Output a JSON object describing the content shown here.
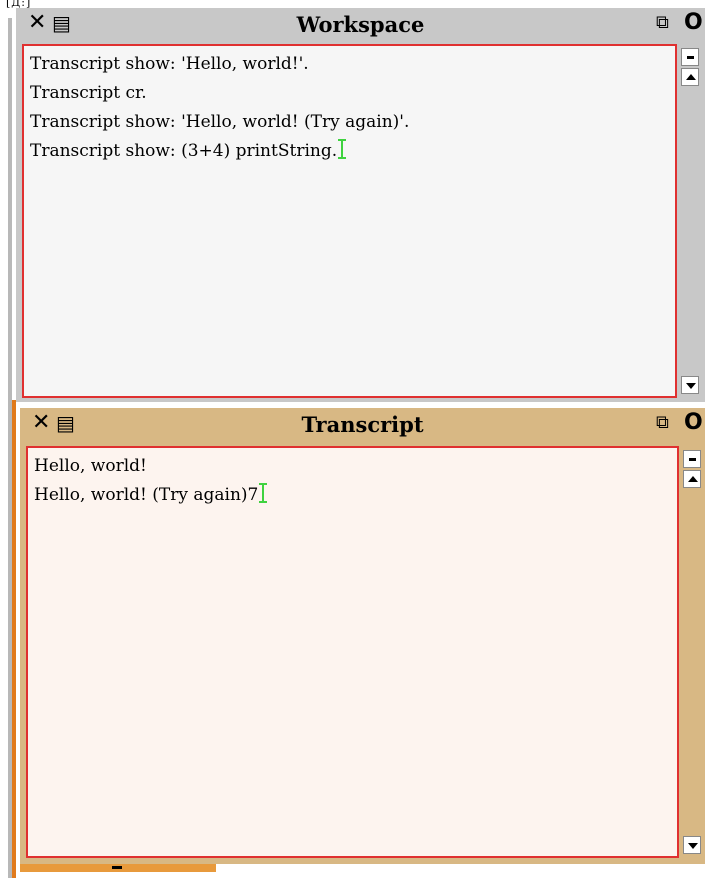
{
  "top_fragment": "[Д:]",
  "workspace": {
    "title": "Workspace",
    "close_glyph": "✕",
    "menu_glyph": "▤",
    "collapse_glyph": "⧉",
    "expand_glyph": "O",
    "lines": [
      "Transcript show: 'Hello, world!'.",
      "Transcript cr.",
      "Transcript show: 'Hello, world! (Try again)'.",
      "Transcript show: (3+4) printString."
    ],
    "colors": {
      "titlebar": "#c8c8c8",
      "pane_bg": "#f6f6f6",
      "border": "#e03030",
      "scroll_track": "#c8c8c8"
    }
  },
  "transcript": {
    "title": "Transcript",
    "close_glyph": "✕",
    "menu_glyph": "▤",
    "collapse_glyph": "⧉",
    "expand_glyph": "O",
    "lines": [
      "Hello, world!",
      "Hello, world! (Try again)7"
    ],
    "colors": {
      "titlebar": "#d8b884",
      "pane_bg": "#fdf4ef",
      "border": "#e03030",
      "scroll_track": "#d8b884"
    }
  },
  "icons": {
    "close": "close-icon",
    "window_menu": "window-menu-icon",
    "collapse": "collapse-icon",
    "expand": "expand-icon",
    "text_cursor": "text-cursor-icon",
    "scroll_up": "scroll-up-arrow-icon",
    "scroll_down": "scroll-down-arrow-icon"
  }
}
